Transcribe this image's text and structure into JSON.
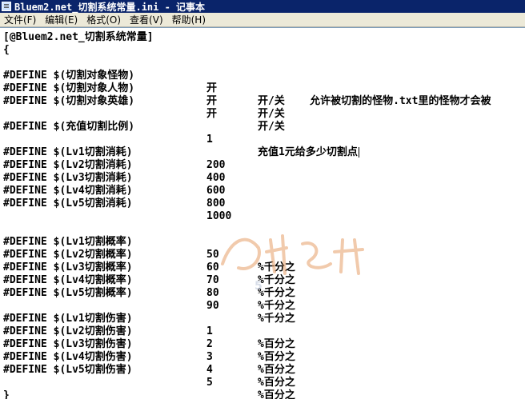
{
  "window": {
    "title": "Bluem2.net_切割系统常量.ini - 记事本"
  },
  "menu": {
    "file": "文件(F)",
    "edit": "编辑(E)",
    "format": "格式(O)",
    "view": "查看(V)",
    "help": "帮助(H)"
  },
  "editor": {
    "header": "[@Bluem2.net_切割系统常量]",
    "open_brace": "{",
    "close_brace": "}",
    "monster": {
      "key": "#DEFINE $(切割对象怪物)",
      "value": "开",
      "note": "开/关    允许被切割的怪物.txt里的怪物才会被"
    },
    "human": {
      "key": "#DEFINE $(切割对象人物)",
      "value": "开",
      "note": "开/关"
    },
    "hero": {
      "key": "#DEFINE $(切割对象英雄)",
      "value": "开",
      "note": "开/关"
    },
    "recharge": {
      "key": "#DEFINE $(充值切割比例)",
      "value": "1",
      "note": "充值1元给多少切割点"
    },
    "cost": [
      {
        "key": "#DEFINE $(Lv1切割消耗)",
        "value": "200"
      },
      {
        "key": "#DEFINE $(Lv2切割消耗)",
        "value": "400"
      },
      {
        "key": "#DEFINE $(Lv3切割消耗)",
        "value": "600"
      },
      {
        "key": "#DEFINE $(Lv4切割消耗)",
        "value": "800"
      },
      {
        "key": "#DEFINE $(Lv5切割消耗)",
        "value": "1000"
      }
    ],
    "rate": [
      {
        "key": "#DEFINE $(Lv1切割概率)",
        "value": "50",
        "note": "%千分之"
      },
      {
        "key": "#DEFINE $(Lv2切割概率)",
        "value": "60",
        "note": "%千分之"
      },
      {
        "key": "#DEFINE $(Lv3切割概率)",
        "value": "70",
        "note": "%千分之"
      },
      {
        "key": "#DEFINE $(Lv4切割概率)",
        "value": "80",
        "note": "%千分之"
      },
      {
        "key": "#DEFINE $(Lv5切割概率)",
        "value": "90",
        "note": "%千分之"
      }
    ],
    "damage": [
      {
        "key": "#DEFINE $(Lv1切割伤害)",
        "value": "1",
        "note": "%百分之"
      },
      {
        "key": "#DEFINE $(Lv2切割伤害)",
        "value": "2",
        "note": "%百分之"
      },
      {
        "key": "#DEFINE $(Lv3切割伤害)",
        "value": "3",
        "note": "%百分之"
      },
      {
        "key": "#DEFINE $(Lv4切割伤害)",
        "value": "4",
        "note": "%百分之"
      },
      {
        "key": "#DEFINE $(Lv5切割伤害)",
        "value": "5",
        "note": "%百分之"
      }
    ]
  },
  "watermark": {
    "text": "5"
  }
}
